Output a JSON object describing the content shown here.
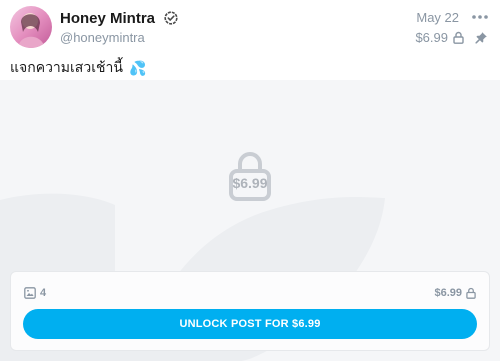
{
  "author": {
    "name": "Honey Mintra",
    "handle": "@honeymintra",
    "verified": true
  },
  "post": {
    "date": "May 22",
    "price": "$6.99",
    "text": "แจกความเสวเช้านี้",
    "emoji": "💦"
  },
  "media": {
    "locked_price": "$6.99",
    "count": "4",
    "price": "$6.99",
    "unlock_label": "UNLOCK POST FOR $6.99"
  },
  "colors": {
    "accent": "#00aff0",
    "muted_text": "#8a96a3",
    "media_background": "#f5f6f8"
  },
  "icons": [
    "verified-icon",
    "more-icon",
    "lock-icon",
    "pin-icon",
    "image-icon",
    "lock-large-icon"
  ]
}
